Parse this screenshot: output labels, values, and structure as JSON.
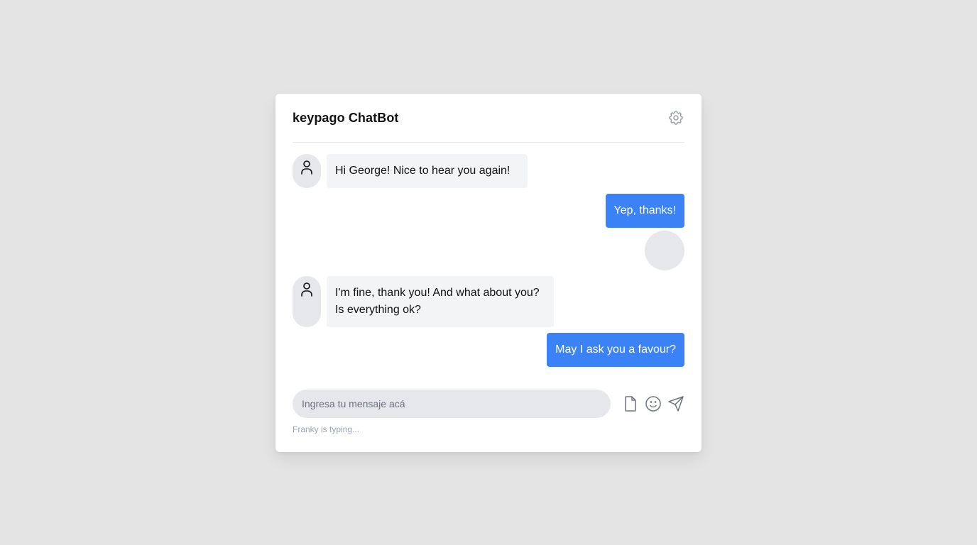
{
  "header": {
    "title": "keypago ChatBot",
    "settings_icon": "gear-icon"
  },
  "messages": [
    {
      "side": "left",
      "text": "Hi George! Nice to hear you again!",
      "avatar_icon": "user-icon"
    },
    {
      "side": "right",
      "text": "Yep, thanks!"
    },
    {
      "side": "left",
      "text": "I'm fine, thank you! And what about you? Is everything ok?",
      "avatar_icon": "user-icon"
    },
    {
      "side": "right",
      "text": "May I ask you a favour?"
    }
  ],
  "composer": {
    "placeholder": "Ingresa tu mensaje acá",
    "value": "",
    "icons": [
      "file-icon",
      "smile-icon",
      "send-icon"
    ]
  },
  "status": {
    "typing": "Franky is typing..."
  },
  "colors": {
    "accent": "#3b82f6",
    "bot_bubble": "#f3f4f6",
    "avatar_bg": "#e5e7eb",
    "page_bg": "#e4e4e5"
  }
}
